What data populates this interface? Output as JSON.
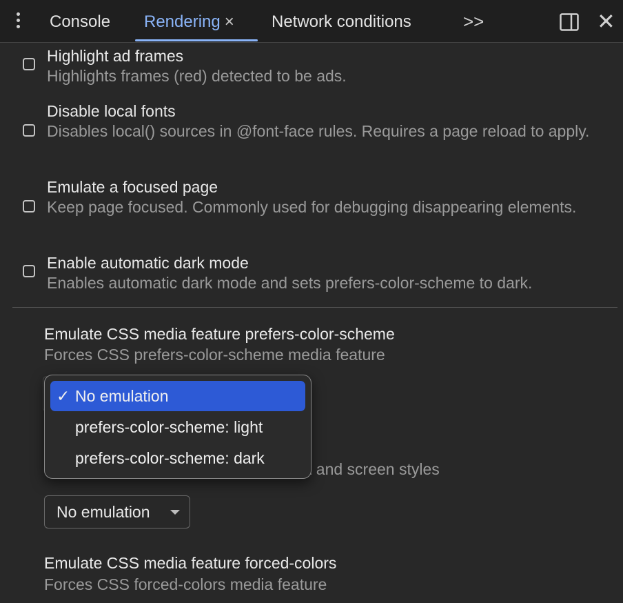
{
  "tabs": {
    "console": "Console",
    "rendering": "Rendering",
    "rendering_close": "×",
    "network": "Network conditions",
    "more": ">>",
    "close": "✕"
  },
  "options": [
    {
      "title": "Highlight ad frames",
      "desc": "Highlights frames (red) detected to be ads.",
      "checked": false
    },
    {
      "title": "Disable local fonts",
      "desc": "Disables local() sources in @font-face rules. Requires a page reload to apply.",
      "checked": false
    },
    {
      "title": "Emulate a focused page",
      "desc": "Keep page focused. Commonly used for debugging disappearing elements.",
      "checked": false
    },
    {
      "title": "Enable automatic dark mode",
      "desc": "Enables automatic dark mode and sets prefers-color-scheme to dark.",
      "checked": false
    }
  ],
  "color_scheme": {
    "title": "Emulate CSS media feature prefers-color-scheme",
    "desc": "Forces CSS prefers-color-scheme media feature"
  },
  "media_type": {
    "desc_partial": "t and screen styles",
    "select_value": "No emulation"
  },
  "forced_colors": {
    "title": "Emulate CSS media feature forced-colors",
    "desc": "Forces CSS forced-colors media feature"
  },
  "dropdown": {
    "check": "✓",
    "items": [
      "No emulation",
      "prefers-color-scheme: light",
      "prefers-color-scheme: dark"
    ]
  },
  "colors": {
    "background": "#282828",
    "accent": "#8ab4f8",
    "selection": "#2d5ad6"
  }
}
